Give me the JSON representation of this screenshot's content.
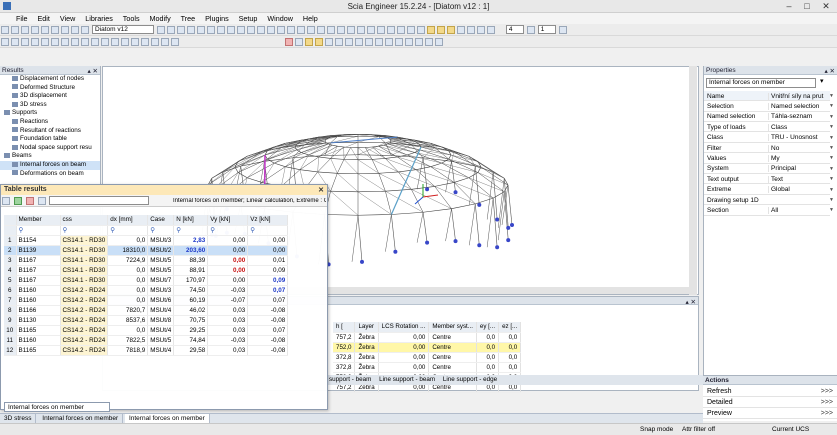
{
  "window": {
    "title": "Scia Engineer 15.2.24 - [Diatom v12 : 1]"
  },
  "menu": [
    "File",
    "Edit",
    "View",
    "Libraries",
    "Tools",
    "Modify",
    "Tree",
    "Plugins",
    "Setup",
    "Window",
    "Help"
  ],
  "toolbar": {
    "project_combo": "Diatom v12",
    "zoom_value": "4",
    "count_value": "1"
  },
  "results_panel": {
    "title": "Results",
    "items": [
      {
        "label": "Displacement of nodes",
        "indent": 1
      },
      {
        "label": "Deformed Structure",
        "indent": 1
      },
      {
        "label": "3D displacement",
        "indent": 1
      },
      {
        "label": "3D stress",
        "indent": 1
      },
      {
        "label": "Supports",
        "indent": 0
      },
      {
        "label": "Reactions",
        "indent": 1
      },
      {
        "label": "Resultant of reactions",
        "indent": 1
      },
      {
        "label": "Foundation table",
        "indent": 1
      },
      {
        "label": "Nodal space support resu",
        "indent": 1
      },
      {
        "label": "Beams",
        "indent": 0
      },
      {
        "label": "Internal forces on beam",
        "indent": 1,
        "selected": true
      },
      {
        "label": "Deformations on beam",
        "indent": 1
      }
    ]
  },
  "table_results": {
    "title": "Table results",
    "description": "Internal forces on member; Linear calculation, Extreme : Glob",
    "columns": [
      "Member",
      "css",
      "dx [mm]",
      "Case",
      "N [kN]",
      "Vy [kN]",
      "Vz [kN]"
    ],
    "rows": [
      {
        "n": "1",
        "member": "B1154",
        "css": "CS14.1 - RD30",
        "dx": "0,0",
        "case": "MSUt/3",
        "N": "2,83",
        "Vy": "0,00",
        "Vz": "0,00",
        "nb": true
      },
      {
        "n": "2",
        "member": "B1139",
        "css": "CS14.1 - RD30",
        "dx": "18310,0",
        "case": "MSUt/2",
        "N": "203,60",
        "Vy": "0,00",
        "Vz": "0,00",
        "nb": true,
        "sel": true
      },
      {
        "n": "3",
        "member": "B1167",
        "css": "CS14.1 - RD30",
        "dx": "7224,9",
        "case": "MSUt/5",
        "N": "88,39",
        "Vy": "0,00",
        "Vz": "0,01",
        "vyr": true
      },
      {
        "n": "4",
        "member": "B1167",
        "css": "CS14.1 - RD30",
        "dx": "0,0",
        "case": "MSUt/5",
        "N": "88,91",
        "Vy": "0,00",
        "Vz": "0,09",
        "vyr": true
      },
      {
        "n": "5",
        "member": "B1167",
        "css": "CS14.1 - RD30",
        "dx": "0,0",
        "case": "MSUt/7",
        "N": "170,97",
        "Vy": "0,00",
        "Vz": "0,09",
        "vzb": true
      },
      {
        "n": "6",
        "member": "B1160",
        "css": "CS14.2 - RD24",
        "dx": "0,0",
        "case": "MSUt/3",
        "N": "74,50",
        "Vy": "-0,03",
        "Vz": "0,07",
        "vzb": true
      },
      {
        "n": "7",
        "member": "B1160",
        "css": "CS14.2 - RD24",
        "dx": "0,0",
        "case": "MSUt/6",
        "N": "60,19",
        "Vy": "-0,07",
        "Vz": "0,07"
      },
      {
        "n": "8",
        "member": "B1166",
        "css": "CS14.2 - RD24",
        "dx": "7820,7",
        "case": "MSUt/4",
        "N": "46,02",
        "Vy": "0,03",
        "Vz": "-0,08"
      },
      {
        "n": "9",
        "member": "B1130",
        "css": "CS14.2 - RD24",
        "dx": "8537,6",
        "case": "MSUt/8",
        "N": "70,75",
        "Vy": "0,03",
        "Vz": "-0,08"
      },
      {
        "n": "10",
        "member": "B1165",
        "css": "CS14.2 - RD24",
        "dx": "0,0",
        "case": "MSUt/4",
        "N": "29,25",
        "Vy": "0,03",
        "Vz": "0,07"
      },
      {
        "n": "11",
        "member": "B1160",
        "css": "CS14.2 - RD24",
        "dx": "7822,5",
        "case": "MSUt/5",
        "N": "74,84",
        "Vy": "-0,03",
        "Vz": "-0,08"
      },
      {
        "n": "12",
        "member": "B1165",
        "css": "CS14.2 - RD24",
        "dx": "7818,9",
        "case": "MSUt/4",
        "N": "29,58",
        "Vy": "0,03",
        "Vz": "-0,08"
      }
    ],
    "tab_label": "Internal forces on member"
  },
  "lower_table": {
    "columns": [
      "h [",
      "Layer",
      "LCS Rotation ...",
      "Member syst...",
      "ey [...",
      "ez [..."
    ],
    "rows": [
      {
        "h": "757,2",
        "layer": "Žebra",
        "rot": "0,00",
        "sys": "Centre",
        "ey": "0,0",
        "ez": "0,0"
      },
      {
        "h": "752,0",
        "layer": "Žebra",
        "rot": "0,00",
        "sys": "Centre",
        "ey": "0,0",
        "ez": "0,0",
        "hl": true
      },
      {
        "h": "372,8",
        "layer": "Žebra",
        "rot": "0,00",
        "sys": "Centre",
        "ey": "0,0",
        "ez": "0,0"
      },
      {
        "h": "372,8",
        "layer": "Žebra",
        "rot": "0,00",
        "sys": "Centre",
        "ey": "0,0",
        "ez": "0,0"
      },
      {
        "h": "752,0",
        "layer": "Žebra",
        "rot": "0,00",
        "sys": "Centre",
        "ey": "0,0",
        "ez": "0,0"
      },
      {
        "h": "757,2",
        "layer": "Žebra",
        "rot": "0,00",
        "sys": "Centre",
        "ey": "0,0",
        "ez": "0,0"
      }
    ],
    "tabs": [
      "support - beam",
      "Line support - beam",
      "Line support - edge"
    ]
  },
  "properties": {
    "title": "Properties",
    "selector": "Internal forces on member",
    "rows": [
      {
        "k": "Name",
        "v": "Vnitřní síly na prut"
      },
      {
        "k": "Selection",
        "v": "Named selection"
      },
      {
        "k": "Named selection",
        "v": "Táhla-seznam"
      },
      {
        "k": "Type of loads",
        "v": "Class"
      },
      {
        "k": "Class",
        "v": "TRU - Únosnost"
      },
      {
        "k": "Filter",
        "v": "No"
      },
      {
        "k": "Values",
        "v": "My"
      },
      {
        "k": "System",
        "v": "Principal"
      },
      {
        "k": "Text output",
        "v": "Text"
      },
      {
        "k": "Extreme",
        "v": "Global"
      },
      {
        "k": "Drawing setup 1D",
        "v": ""
      },
      {
        "k": "Section",
        "v": "All"
      }
    ]
  },
  "actions": {
    "title": "Actions",
    "items": [
      {
        "label": "Refresh",
        "arrow": ">>>"
      },
      {
        "label": "Detailed",
        "arrow": ">>>"
      },
      {
        "label": "Preview",
        "arrow": ">>>"
      }
    ]
  },
  "doc_tabs": [
    "3D stress",
    "Internal forces on member",
    "Internal forces on member"
  ],
  "status": {
    "snap": "Snap mode",
    "attr": "Attr filter off",
    "ucs": "Current UCS"
  },
  "colors": {
    "accent": "#c8d8ee",
    "highlight": "#fff7a8",
    "result_header": "#fde8b8"
  }
}
